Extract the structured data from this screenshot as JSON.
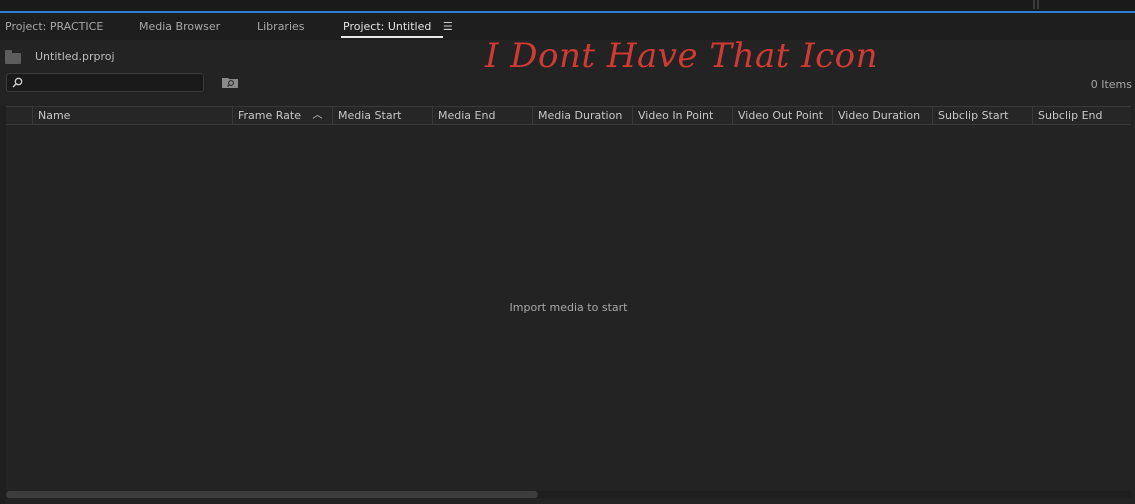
{
  "tabs": [
    {
      "label": "Project: PRACTICE",
      "active": false
    },
    {
      "label": "Media Browser",
      "active": false
    },
    {
      "label": "Libraries",
      "active": false
    },
    {
      "label": "Project: Untitled",
      "active": true
    }
  ],
  "panel_menu_icon": "hamburger-menu-icon",
  "project_file": "Untitled.prproj",
  "annotation_text": "I Dont Have That Icon",
  "search": {
    "value": "",
    "placeholder": ""
  },
  "items_count": "0 Items",
  "columns": [
    {
      "label": "Name"
    },
    {
      "label": "Frame Rate",
      "sort": "ascending"
    },
    {
      "label": "Media Start"
    },
    {
      "label": "Media End"
    },
    {
      "label": "Media Duration"
    },
    {
      "label": "Video In Point"
    },
    {
      "label": "Video Out Point"
    },
    {
      "label": "Video Duration"
    },
    {
      "label": "Subclip Start"
    },
    {
      "label": "Subclip End"
    }
  ],
  "empty_message": "Import media to start",
  "colors": {
    "accent_blue": "#2f7fd6",
    "annotation_red": "#cf3a34",
    "panel_bg": "#232323"
  }
}
